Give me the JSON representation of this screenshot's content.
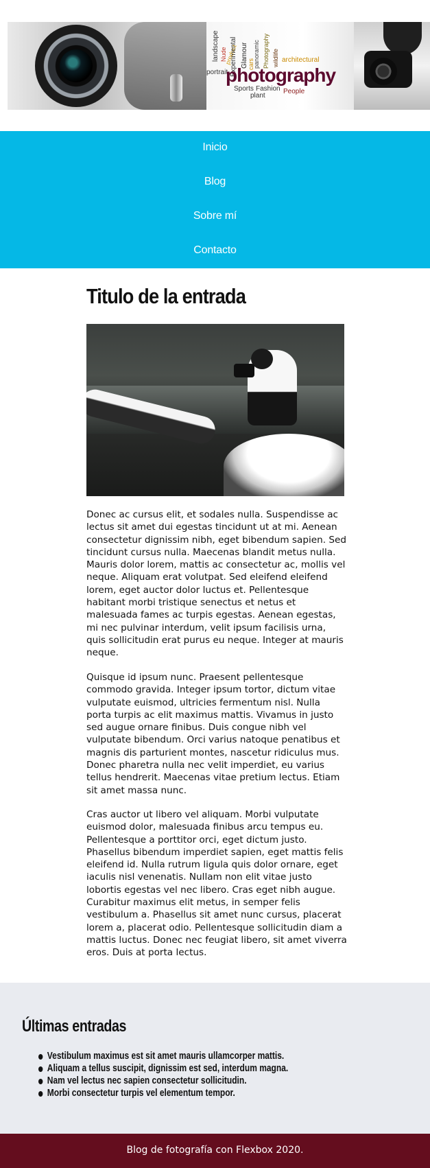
{
  "header": {
    "banner_alt": "photography",
    "banner_words": {
      "main": "photography",
      "landscape": "landscape",
      "portrait": "portrait",
      "nude": "Nude",
      "product": "product",
      "experimental": "Experimental",
      "glamour": "Glamour",
      "cars": "cars",
      "panoramic": "panoramic",
      "photography_small": "Photography",
      "wildlife": "wildlife",
      "architectural": "architectural",
      "sports": "Sports",
      "fashion": "Fashion",
      "plant": "plant",
      "people": "People"
    }
  },
  "nav": {
    "items": [
      {
        "label": "Inicio"
      },
      {
        "label": "Blog"
      },
      {
        "label": "Sobre mí"
      },
      {
        "label": "Contacto"
      }
    ]
  },
  "post": {
    "title": "Titulo de la entrada",
    "paragraphs": [
      "Donec ac cursus elit, et sodales nulla. Suspendisse ac lectus sit amet dui egestas tincidunt ut at mi. Aenean consectetur dignissim nibh, eget bibendum sapien. Sed tincidunt cursus nulla. Maecenas blandit metus nulla. Mauris dolor lorem, mattis ac consectetur ac, mollis vel neque. Aliquam erat volutpat. Sed eleifend eleifend lorem, eget auctor dolor luctus et. Pellentesque habitant morbi tristique senectus et netus et malesuada fames ac turpis egestas. Aenean egestas, mi nec pulvinar interdum, velit ipsum facilisis urna, quis sollicitudin erat purus eu neque. Integer at mauris neque.",
      "Quisque id ipsum nunc. Praesent pellentesque commodo gravida. Integer ipsum tortor, dictum vitae vulputate euismod, ultricies fermentum nisl. Nulla porta turpis ac elit maximus mattis. Vivamus in justo sed augue ornare finibus. Duis congue nibh vel vulputate bibendum. Orci varius natoque penatibus et magnis dis parturient montes, nascetur ridiculus mus. Donec pharetra nulla nec velit imperdiet, eu varius tellus hendrerit. Maecenas vitae pretium lectus. Etiam sit amet massa nunc.",
      "Cras auctor ut libero vel aliquam. Morbi vulputate euismod dolor, malesuada finibus arcu tempus eu. Pellentesque a porttitor orci, eget dictum justo. Phasellus bibendum imperdiet sapien, eget mattis felis eleifend id. Nulla rutrum ligula quis dolor ornare, eget iaculis nisl venenatis. Nullam non elit vitae justo lobortis egestas vel nec libero. Cras eget nibh augue. Curabitur maximus elit metus, in semper felis vestibulum a. Phasellus sit amet nunc cursus, placerat lorem a, placerat odio. Pellentesque sollicitudin diam a mattis luctus. Donec nec feugiat libero, sit amet viverra eros. Duis at porta lectus."
    ]
  },
  "latest": {
    "title": "Últimas entradas",
    "items": [
      "Vestibulum maximus est sit amet mauris ullamcorper mattis.",
      "Aliquam a tellus suscipit, dignissim est sed, interdum magna.",
      "Nam vel lectus nec sapien consectetur sollicitudin.",
      "Morbi consectetur turpis vel elementum tempor."
    ]
  },
  "footer": {
    "text": "Blog de fotografía con Flexbox 2020."
  },
  "colors": {
    "nav_bg": "#05b8e6",
    "latest_bg": "#e9ebf0",
    "footer_bg": "#640d1e",
    "banner_main_word": "#5c0a2e"
  }
}
